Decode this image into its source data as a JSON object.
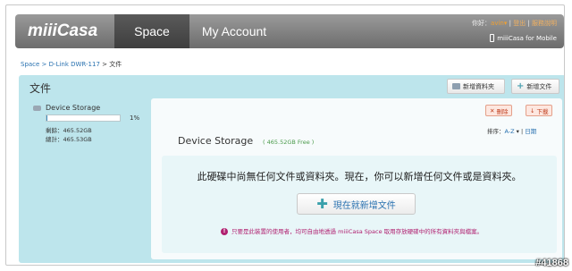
{
  "header": {
    "logo": "miiiCasa",
    "tabs": [
      {
        "label": "Space"
      },
      {
        "label": "My Account"
      }
    ],
    "greeting": "你好：",
    "user": "avin",
    "dropdown": "▾",
    "sep1": " | ",
    "logout": "登出",
    "sep2": " | ",
    "help": "服務說明",
    "mobile": "miiiCasa for Mobile"
  },
  "breadcrumb": {
    "link": "Space > D-Link DWR-117",
    "rest": " > 文件"
  },
  "panel": {
    "title": "文件",
    "new_folder": "新增資料夾",
    "new_file": "新增文件"
  },
  "sidebar": {
    "device_name": "Device Storage",
    "usage_fraction": 0.01,
    "usage_pct": "1%",
    "remaining": "剩餘：465.52GB",
    "total": "總計：465.53GB"
  },
  "content": {
    "delete_label": "刪除",
    "download_label": "下載",
    "sort_label": "排序：",
    "sort_az": "A-Z",
    "sort_sep": " ▾ | ",
    "sort_date": "日期",
    "title": "Device Storage",
    "free": "( 465.52GB Free )",
    "empty_msg": "此硬碟中尚無任何文件或資料夾。現在，你可以新增任何文件或是資料夾。",
    "add_now": "現在就新增文件",
    "note": "只要是此裝置的使用者，均可自由地透過 miiiCasa Space 取用存放硬碟中的所有資料夾與檔案。"
  },
  "watermark": "#41868",
  "colors": {
    "accent": "#2a72b0",
    "panel": "#bde5ec",
    "note": "#b02070"
  }
}
